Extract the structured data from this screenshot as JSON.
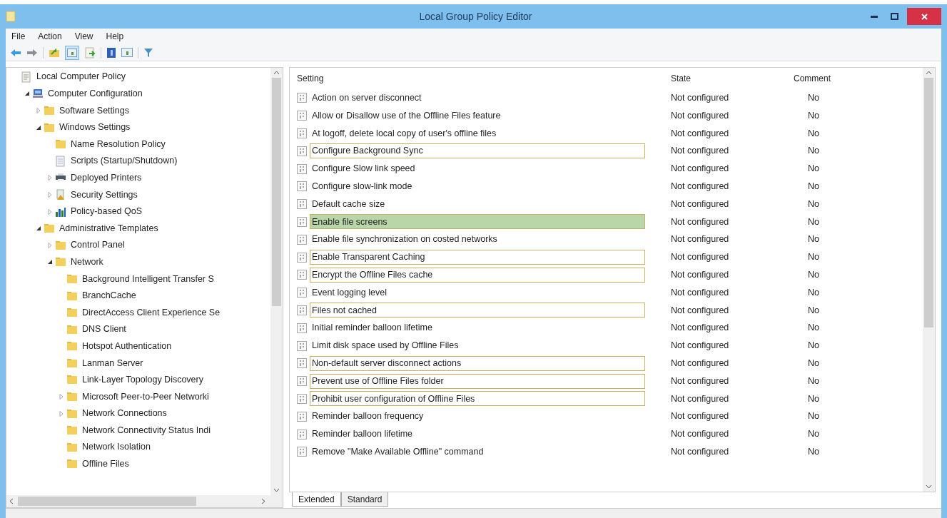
{
  "window": {
    "title": "Local Group Policy Editor"
  },
  "menu": [
    "File",
    "Action",
    "View",
    "Help"
  ],
  "tree": [
    {
      "label": "Local Computer Policy",
      "kind": "policy",
      "children": [
        {
          "label": "Computer Configuration",
          "kind": "computer",
          "expanded": true,
          "children": [
            {
              "label": "Software Settings",
              "kind": "folder",
              "expanded": false
            },
            {
              "label": "Windows Settings",
              "kind": "folder",
              "expanded": true,
              "children": [
                {
                  "label": "Name Resolution Policy",
                  "kind": "folder"
                },
                {
                  "label": "Scripts (Startup/Shutdown)",
                  "kind": "script"
                },
                {
                  "label": "Deployed Printers",
                  "kind": "printer",
                  "expanded": false
                },
                {
                  "label": "Security Settings",
                  "kind": "security",
                  "expanded": false
                },
                {
                  "label": "Policy-based QoS",
                  "kind": "qos",
                  "expanded": false
                }
              ]
            },
            {
              "label": "Administrative Templates",
              "kind": "folder",
              "expanded": true,
              "children": [
                {
                  "label": "Control Panel",
                  "kind": "folder",
                  "expanded": false
                },
                {
                  "label": "Network",
                  "kind": "folder",
                  "expanded": true,
                  "children": [
                    {
                      "label": "Background Intelligent Transfer S",
                      "kind": "folder"
                    },
                    {
                      "label": "BranchCache",
                      "kind": "folder"
                    },
                    {
                      "label": "DirectAccess Client Experience Se",
                      "kind": "folder"
                    },
                    {
                      "label": "DNS Client",
                      "kind": "folder"
                    },
                    {
                      "label": "Hotspot Authentication",
                      "kind": "folder"
                    },
                    {
                      "label": "Lanman Server",
                      "kind": "folder"
                    },
                    {
                      "label": "Link-Layer Topology Discovery",
                      "kind": "folder"
                    },
                    {
                      "label": "Microsoft Peer-to-Peer Networki",
                      "kind": "folder",
                      "expanded": false
                    },
                    {
                      "label": "Network Connections",
                      "kind": "folder",
                      "expanded": false
                    },
                    {
                      "label": "Network Connectivity Status Indi",
                      "kind": "folder"
                    },
                    {
                      "label": "Network Isolation",
                      "kind": "folder"
                    },
                    {
                      "label": "Offline Files",
                      "kind": "folder"
                    }
                  ]
                }
              ]
            }
          ]
        }
      ]
    }
  ],
  "table": {
    "columns": [
      "Setting",
      "State",
      "Comment"
    ],
    "rows": [
      {
        "setting": "Action on server disconnect",
        "state": "Not configured",
        "comment": "No",
        "outlined": false,
        "selected": false
      },
      {
        "setting": "Allow or Disallow use of the Offline Files feature",
        "state": "Not configured",
        "comment": "No",
        "outlined": false,
        "selected": false
      },
      {
        "setting": "At logoff, delete local copy of user's offline files",
        "state": "Not configured",
        "comment": "No",
        "outlined": false,
        "selected": false
      },
      {
        "setting": "Configure Background Sync",
        "state": "Not configured",
        "comment": "No",
        "outlined": true,
        "selected": false
      },
      {
        "setting": "Configure Slow link speed",
        "state": "Not configured",
        "comment": "No",
        "outlined": false,
        "selected": false
      },
      {
        "setting": "Configure slow-link mode",
        "state": "Not configured",
        "comment": "No",
        "outlined": false,
        "selected": false
      },
      {
        "setting": "Default cache size",
        "state": "Not configured",
        "comment": "No",
        "outlined": false,
        "selected": false
      },
      {
        "setting": "Enable file screens",
        "state": "Not configured",
        "comment": "No",
        "outlined": true,
        "selected": true
      },
      {
        "setting": "Enable file synchronization on costed networks",
        "state": "Not configured",
        "comment": "No",
        "outlined": false,
        "selected": false
      },
      {
        "setting": "Enable Transparent Caching",
        "state": "Not configured",
        "comment": "No",
        "outlined": true,
        "selected": false
      },
      {
        "setting": "Encrypt the Offline Files cache",
        "state": "Not configured",
        "comment": "No",
        "outlined": true,
        "selected": false
      },
      {
        "setting": "Event logging level",
        "state": "Not configured",
        "comment": "No",
        "outlined": false,
        "selected": false
      },
      {
        "setting": "Files not cached",
        "state": "Not configured",
        "comment": "No",
        "outlined": true,
        "selected": false
      },
      {
        "setting": "Initial reminder balloon lifetime",
        "state": "Not configured",
        "comment": "No",
        "outlined": false,
        "selected": false
      },
      {
        "setting": "Limit disk space used by Offline Files",
        "state": "Not configured",
        "comment": "No",
        "outlined": false,
        "selected": false
      },
      {
        "setting": "Non-default server disconnect actions",
        "state": "Not configured",
        "comment": "No",
        "outlined": true,
        "selected": false
      },
      {
        "setting": "Prevent use of Offline Files folder",
        "state": "Not configured",
        "comment": "No",
        "outlined": true,
        "selected": false
      },
      {
        "setting": "Prohibit user configuration of Offline Files",
        "state": "Not configured",
        "comment": "No",
        "outlined": true,
        "selected": false
      },
      {
        "setting": "Reminder balloon frequency",
        "state": "Not configured",
        "comment": "No",
        "outlined": false,
        "selected": false
      },
      {
        "setting": "Reminder balloon lifetime",
        "state": "Not configured",
        "comment": "No",
        "outlined": false,
        "selected": false
      },
      {
        "setting": "Remove \"Make Available Offline\" command",
        "state": "Not configured",
        "comment": "No",
        "outlined": false,
        "selected": false
      }
    ]
  },
  "tabs": [
    {
      "label": "Extended",
      "selected": true
    },
    {
      "label": "Standard",
      "selected": false
    }
  ]
}
